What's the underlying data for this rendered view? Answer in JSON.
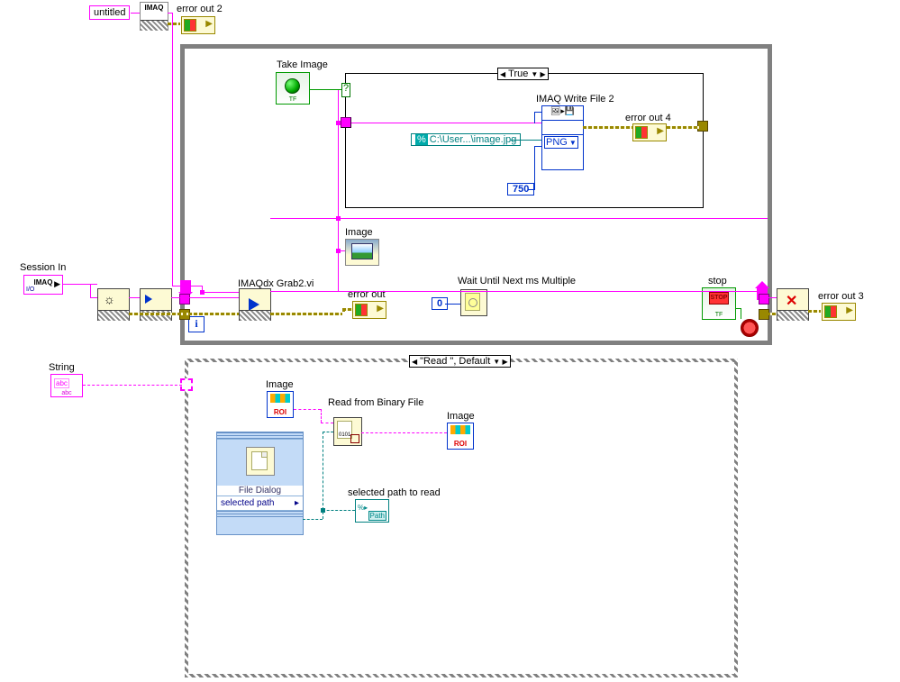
{
  "controls": {
    "untitled": "untitled",
    "session_in": "Session In",
    "take_image": "Take Image",
    "string": "String",
    "stop": "stop"
  },
  "indicators": {
    "error_out_2": "error out 2",
    "error_out": "error out",
    "error_out_3": "error out 3",
    "error_out_4": "error out 4",
    "image": "Image",
    "image_roi1": "Image",
    "image_roi2": "Image",
    "selected_path_to_read": "selected path to read"
  },
  "nodes": {
    "imaq_create": "IMAQ",
    "session_io": "IMAQ",
    "imaqdx_grab": "IMAQdx Grab2.vi",
    "imaq_write_file": "IMAQ Write File 2",
    "wait_ms": "Wait Until Next ms Multiple",
    "read_binary": "Read from Binary File",
    "file_dialog_title": "File Dialog",
    "file_dialog_port": "selected path"
  },
  "constants": {
    "file_path": "C:\\User...\\image.jpg",
    "file_type": "PNG",
    "num1": "750",
    "wait": "0",
    "path_marker": "%"
  },
  "case_selectors": {
    "top": "True",
    "bottom": "\"Read \", Default"
  },
  "icons": {
    "i": "i",
    "path": "Path",
    "abc": "abc",
    "tf": "TF",
    "stop_txt": "STOP",
    "binary_txt": "0101"
  }
}
